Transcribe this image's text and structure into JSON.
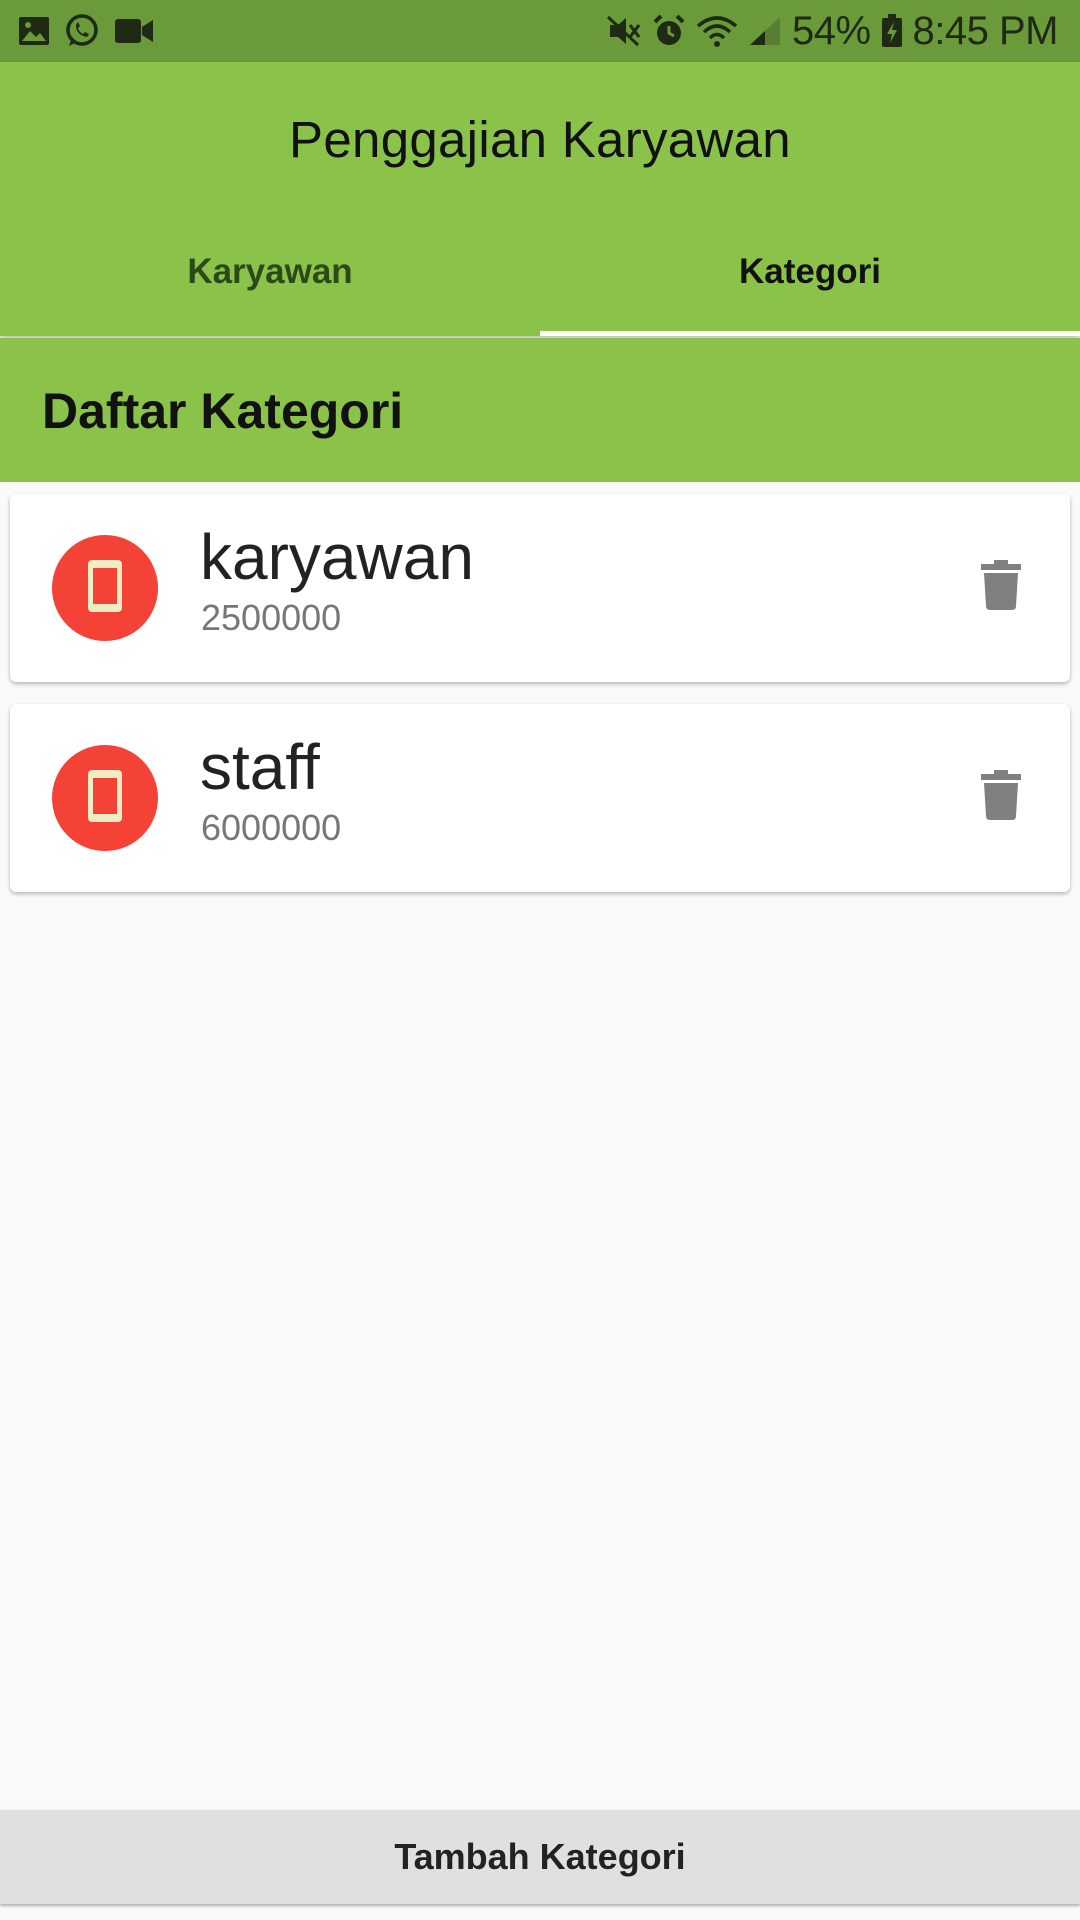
{
  "status_bar": {
    "left_icons": [
      "image-icon",
      "whatsapp-icon",
      "video-camera-icon"
    ],
    "right_icons": [
      "mute-icon",
      "alarm-icon",
      "wifi-icon",
      "signal-icon",
      "battery-charging-icon"
    ],
    "battery": "54%",
    "time": "8:45 PM"
  },
  "app_bar": {
    "title": "Penggajian Karyawan",
    "tabs": [
      {
        "label": "Karyawan",
        "active": false
      },
      {
        "label": "Kategori",
        "active": true
      }
    ]
  },
  "section": {
    "title": "Daftar Kategori"
  },
  "items": [
    {
      "title": "karyawan",
      "subtitle": "2500000",
      "icon": "phone-icon",
      "action_icon": "trash-icon"
    },
    {
      "title": "staff",
      "subtitle": "6000000",
      "icon": "phone-icon",
      "action_icon": "trash-icon"
    }
  ],
  "bottom_button": {
    "label": "Tambah Kategori"
  },
  "colors": {
    "status_bar": "#6b9a3a",
    "primary": "#8bc34a",
    "avatar": "#f44336",
    "avatar_icon": "#f0ecc4",
    "tab_indicator": "#ffffff",
    "button_bg": "#e0e0e0"
  }
}
